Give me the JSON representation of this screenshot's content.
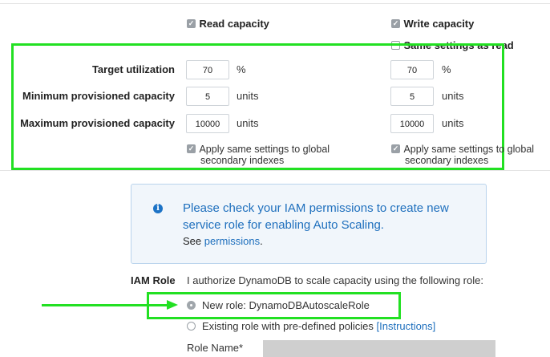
{
  "header": {
    "read_label": "Read capacity",
    "write_label": "Write capacity",
    "same_settings_label": "Same settings as read"
  },
  "rows": {
    "target_label": "Target utilization",
    "min_label": "Minimum provisioned capacity",
    "max_label": "Maximum provisioned capacity"
  },
  "read": {
    "target": "70",
    "target_unit": "%",
    "min": "5",
    "min_unit": "units",
    "max": "10000",
    "max_unit": "units"
  },
  "write": {
    "target": "70",
    "target_unit": "%",
    "min": "5",
    "min_unit": "units",
    "max": "10000",
    "max_unit": "units"
  },
  "apply": {
    "read_line1": "Apply same settings to global",
    "read_line2": "secondary indexes",
    "write_line1": "Apply same settings to global",
    "write_line2": "secondary indexes"
  },
  "info": {
    "line1": "Please check your IAM permissions to create new",
    "line2": "service role for enabling Auto Scaling.",
    "see_prefix": "See ",
    "see_link": "permissions",
    "see_suffix": "."
  },
  "iam": {
    "label": "IAM Role",
    "description": "I authorize DynamoDB to scale capacity using the following role:",
    "new_role": "New role: DynamoDBAutoscaleRole",
    "existing_role": "Existing role with pre-defined policies",
    "instructions": "[Instructions]",
    "role_name_label": "Role Name*"
  },
  "colors": {
    "highlight": "#22e022",
    "link": "#1e6fbd",
    "info_bg": "#f1f6fb"
  }
}
